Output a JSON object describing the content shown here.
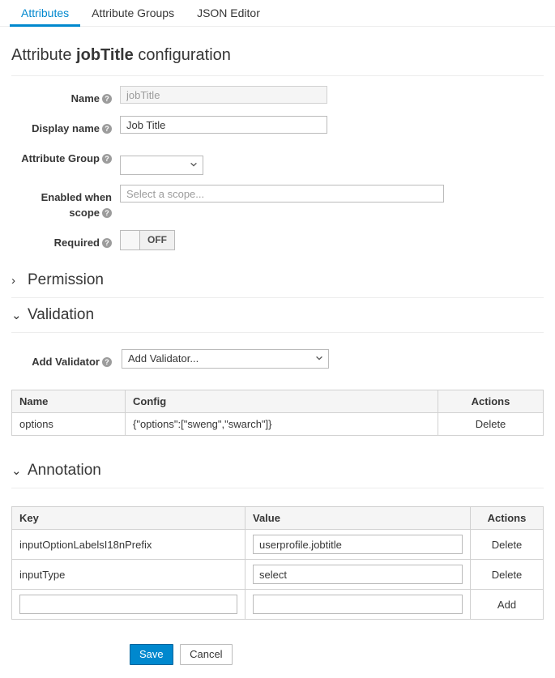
{
  "tabs": [
    {
      "label": "Attributes",
      "active": true
    },
    {
      "label": "Attribute Groups",
      "active": false
    },
    {
      "label": "JSON Editor",
      "active": false
    }
  ],
  "title": {
    "prefix": "Attribute",
    "name": "jobTitle",
    "suffix": "configuration"
  },
  "form": {
    "name": {
      "label": "Name",
      "value": "",
      "placeholder": "jobTitle",
      "disabled": true
    },
    "display_name": {
      "label": "Display name",
      "value": "Job Title",
      "placeholder": ""
    },
    "attribute_group": {
      "label": "Attribute Group",
      "selected": ""
    },
    "enabled_when_scope": {
      "label_line1": "Enabled when",
      "label_line2": "scope",
      "value": "",
      "placeholder": "Select a scope..."
    },
    "required": {
      "label": "Required",
      "state": "OFF"
    }
  },
  "sections": {
    "permission": {
      "label": "Permission",
      "expanded": false,
      "chevron": "›"
    },
    "validation": {
      "label": "Validation",
      "expanded": true,
      "chevron": "⌄"
    },
    "annotation": {
      "label": "Annotation",
      "expanded": true,
      "chevron": "⌄"
    }
  },
  "validation": {
    "add_validator": {
      "label": "Add Validator",
      "selected": "Add Validator..."
    },
    "table": {
      "headers": [
        "Name",
        "Config",
        "Actions"
      ],
      "rows": [
        {
          "name": "options",
          "config": "{\"options\":[\"sweng\",\"swarch\"]}",
          "action": "Delete"
        }
      ]
    }
  },
  "annotation": {
    "table": {
      "headers": [
        "Key",
        "Value",
        "Actions"
      ],
      "rows": [
        {
          "key": "inputOptionLabelsI18nPrefix",
          "value": "userprofile.jobtitle",
          "action": "Delete",
          "key_editable": false
        },
        {
          "key": "inputType",
          "value": "select",
          "action": "Delete",
          "key_editable": false
        },
        {
          "key": "",
          "value": "",
          "action": "Add",
          "key_editable": true
        }
      ]
    }
  },
  "footer": {
    "save": "Save",
    "cancel": "Cancel"
  },
  "colors": {
    "accent": "#0088ce",
    "text": "#363636",
    "muted": "#9c9c9c",
    "border": "#d1d1d1",
    "header_bg": "#f5f5f5"
  },
  "help_glyph": "?"
}
